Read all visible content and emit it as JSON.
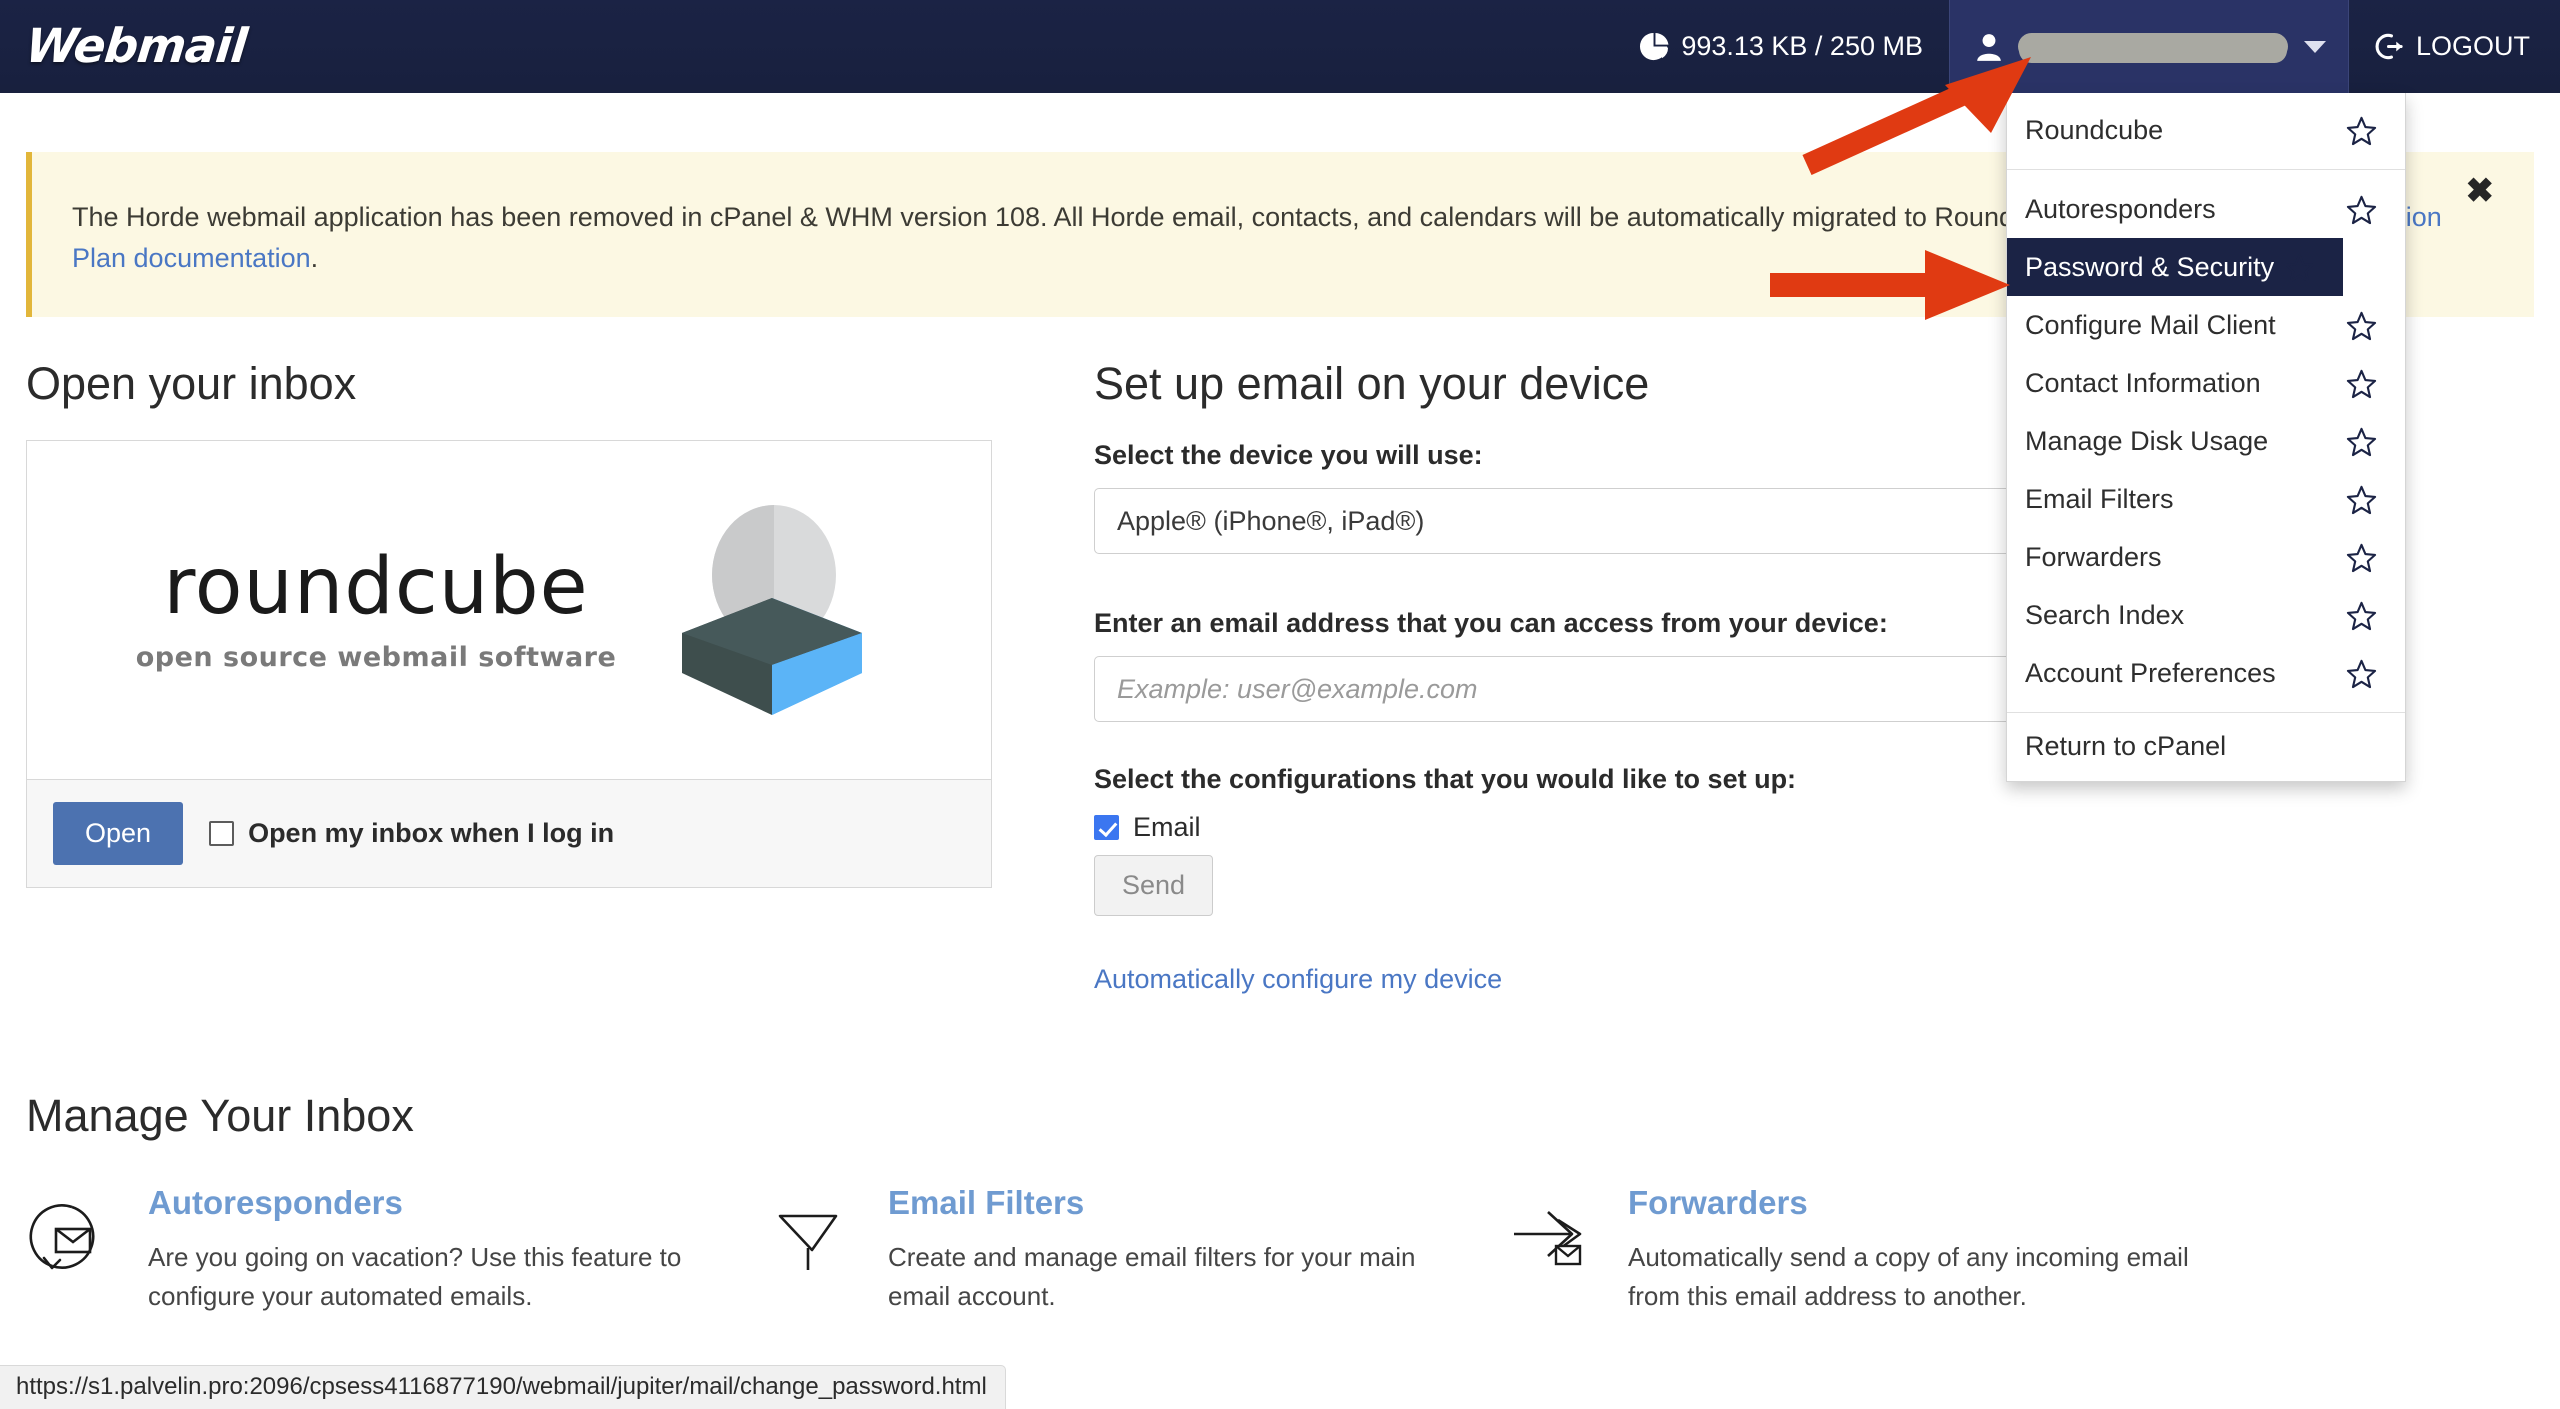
{
  "header": {
    "brand": "Webmail",
    "disk_usage": {
      "icon": "pie-chart-icon",
      "text": "993.13 KB / 250 MB",
      "used": "993.13 KB",
      "quota": "250 MB"
    },
    "user_menu": {
      "icon": "user-icon",
      "username": "",
      "redacted": true,
      "caret": "chevron-down-icon"
    },
    "logout": {
      "icon": "logout-icon",
      "label": "LOGOUT"
    }
  },
  "notice": {
    "text_part1": "The Horde webmail application has been removed in cPanel & WHM version 108. All Horde email, contacts, and calendars will be automatically migrated to Roundcube. Read our ",
    "link_text": "cPanel Deprecation Plan documentation",
    "text_part2": ".",
    "close_label": "✖"
  },
  "dropdown": {
    "items": [
      {
        "label": "Roundcube",
        "star": true,
        "selected": false
      },
      {
        "label": "Autoresponders",
        "star": true,
        "selected": false
      },
      {
        "label": "Password & Security",
        "star": true,
        "selected": true
      },
      {
        "label": "Configure Mail Client",
        "star": true,
        "selected": false
      },
      {
        "label": "Contact Information",
        "star": true,
        "selected": false
      },
      {
        "label": "Manage Disk Usage",
        "star": true,
        "selected": false
      },
      {
        "label": "Email Filters",
        "star": true,
        "selected": false
      },
      {
        "label": "Forwarders",
        "star": true,
        "selected": false
      },
      {
        "label": "Search Index",
        "star": true,
        "selected": false
      },
      {
        "label": "Account Preferences",
        "star": true,
        "selected": false
      }
    ],
    "footer_item": {
      "label": "Return to cPanel",
      "star": false
    }
  },
  "inbox": {
    "section_title": "Open your inbox",
    "logo_name": "roundcube",
    "logo_tagline": "open source webmail software",
    "open_button": "Open",
    "checkbox_label": "Open my inbox when I log in",
    "checkbox_checked": false
  },
  "device_setup": {
    "section_title": "Set up email on your device",
    "device_label": "Select the device you will use:",
    "device_value": "Apple® (iPhone®, iPad®)",
    "email_label": "Enter an email address that you can access from your device:",
    "email_value": "",
    "email_placeholder": "Example: user@example.com",
    "config_label": "Select the configurations that you would like to set up:",
    "config_checkbox_label": "Email",
    "config_checkbox_checked": true,
    "send_button": "Send",
    "auto_link": "Automatically configure my device"
  },
  "manage": {
    "section_title": "Manage Your Inbox",
    "cards": [
      {
        "icon": "autoresponder-icon",
        "title": "Autoresponders",
        "desc": "Are you going on vacation? Use this feature to configure your automated emails."
      },
      {
        "icon": "funnel-icon",
        "title": "Email Filters",
        "desc": "Create and manage email filters for your main email account."
      },
      {
        "icon": "forward-arrow-icon",
        "title": "Forwarders",
        "desc": "Automatically send a copy of any incoming email from this email address to another."
      }
    ]
  },
  "statusbar": {
    "url": "https://s1.palvelin.pro:2096/cpsess4116877190/webmail/jupiter/mail/change_password.html"
  },
  "annotations": {
    "arrow_color": "#e03a12",
    "arrows": [
      {
        "name": "arrow-to-user-menu",
        "direction": "up-right"
      },
      {
        "name": "arrow-to-password-security",
        "direction": "right"
      }
    ]
  },
  "colors": {
    "header_bg": "#1b2345",
    "user_btn_bg": "#2a3366",
    "notice_bg": "#fcf8e3",
    "notice_accent": "#e2b63a",
    "link": "#4a77c4",
    "selected_item_bg": "#1b2345",
    "open_button_bg": "#4c72b0",
    "card_title": "#6f9bd1",
    "checkbox_checked": "#3b76f0"
  }
}
